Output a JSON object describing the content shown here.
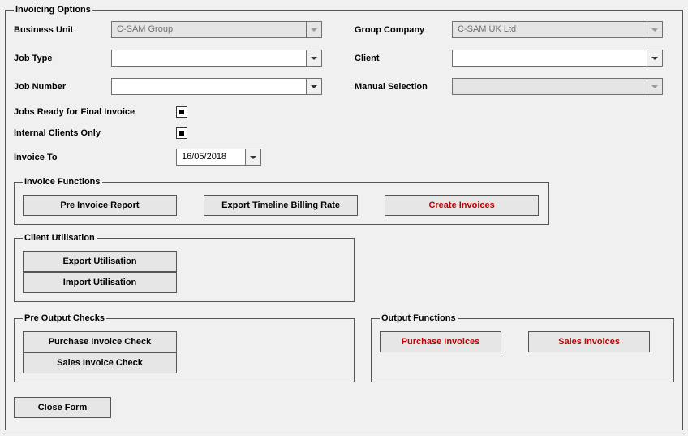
{
  "legend": "Invoicing Options",
  "fields": {
    "business_unit": {
      "label": "Business Unit",
      "value": "C-SAM Group"
    },
    "group_company": {
      "label": "Group Company",
      "value": "C-SAM UK Ltd"
    },
    "job_type": {
      "label": "Job Type",
      "value": ""
    },
    "client": {
      "label": "Client",
      "value": ""
    },
    "job_number": {
      "label": "Job Number",
      "value": ""
    },
    "manual_selection": {
      "label": "Manual Selection",
      "value": ""
    },
    "jobs_ready": {
      "label": "Jobs Ready for Final Invoice"
    },
    "internal_clients": {
      "label": "Internal Clients Only"
    },
    "invoice_to": {
      "label": "Invoice To",
      "value": "16/05/2018"
    }
  },
  "groups": {
    "invoice_functions": {
      "legend": "Invoice Functions",
      "pre_invoice_report": "Pre Invoice Report",
      "export_timeline": "Export Timeline Billing Rate",
      "create_invoices": "Create Invoices"
    },
    "client_utilisation": {
      "legend": "Client Utilisation",
      "export": "Export Utilisation",
      "import": "Import Utilisation"
    },
    "pre_output": {
      "legend": "Pre Output Checks",
      "purchase_check": "Purchase Invoice Check",
      "sales_check": "Sales Invoice Check"
    },
    "output_functions": {
      "legend": "Output Functions",
      "purchase_invoices": "Purchase Invoices",
      "sales_invoices": "Sales Invoices"
    }
  },
  "close_form": "Close Form"
}
